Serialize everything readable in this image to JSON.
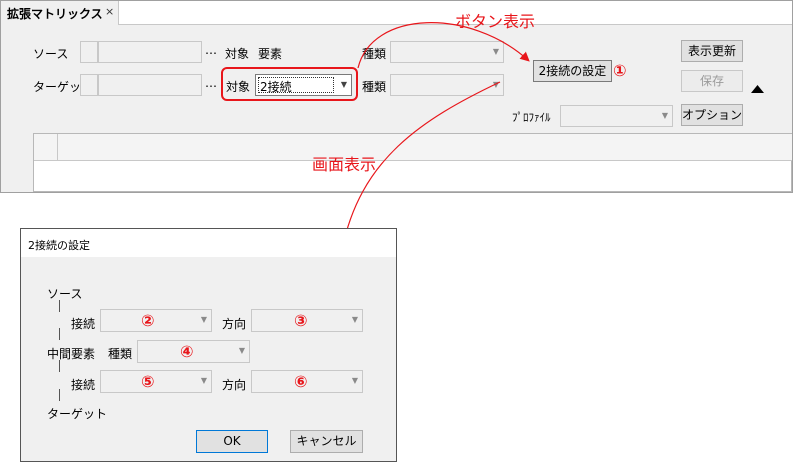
{
  "main": {
    "tab_title": "拡張マトリックス",
    "tab_close": "×",
    "source": {
      "label": "ソース",
      "dots": "…",
      "target_label": "対象",
      "target_value": "要素",
      "kind_label": "種類"
    },
    "target": {
      "label": "ターゲット",
      "dots": "…",
      "target_label": "対象",
      "target_value": "2接続",
      "kind_label": "種類"
    },
    "connection_settings_button": "2接続の設定",
    "refresh_button": "表示更新",
    "save_button": "保存",
    "profile_label": "ﾌﾟﾛﾌｧｲﾙ",
    "options_button": "オプション"
  },
  "annotations": {
    "button_display": "ボタン表示",
    "screen_display": "画面表示",
    "marker_1": "①"
  },
  "dialog": {
    "title": "2接続の設定",
    "source_label": "ソース",
    "connection_label": "接続",
    "direction_label": "方向",
    "middle_label": "中間要素",
    "kind_label": "種類",
    "target_label": "ターゲット",
    "ok_button": "OK",
    "cancel_button": "キャンセル",
    "markers": [
      "②",
      "③",
      "④",
      "⑤",
      "⑥"
    ]
  },
  "colors": {
    "annotation": "#e8161b",
    "window_bg": "#f0f0f0"
  }
}
